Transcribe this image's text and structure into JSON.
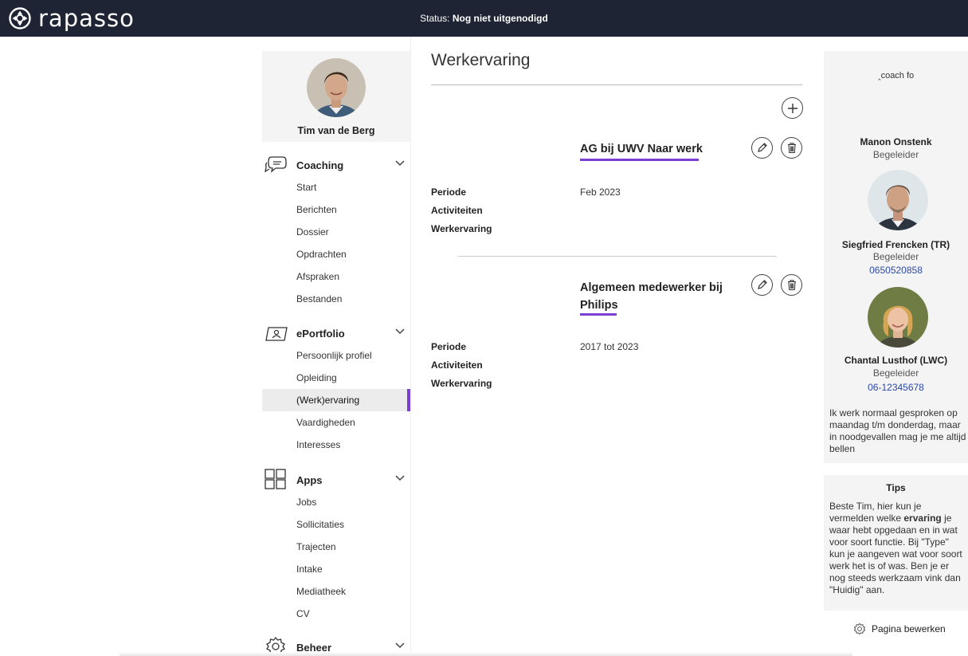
{
  "topbar": {
    "logo_text": "rapasso",
    "status_prefix": "Status:",
    "status_value": "Nog niet uitgenodigd"
  },
  "profile": {
    "name": "Tim van de Berg"
  },
  "nav": {
    "coaching": {
      "title": "Coaching",
      "items": [
        "Start",
        "Berichten",
        "Dossier",
        "Opdrachten",
        "Afspraken",
        "Bestanden"
      ]
    },
    "eportfolio": {
      "title": "ePortfolio",
      "items": [
        "Persoonlijk profiel",
        "Opleiding",
        "(Werk)ervaring",
        "Vaardigheden",
        "Interesses"
      ],
      "active_item": "(Werk)ervaring"
    },
    "apps": {
      "title": "Apps",
      "items": [
        "Jobs",
        "Sollicitaties",
        "Trajecten",
        "Intake",
        "Mediatheek",
        "CV"
      ]
    },
    "beheer": {
      "title": "Beheer"
    }
  },
  "main": {
    "title": "Werkervaring",
    "experiences": [
      {
        "title": "AG bij UWV Naar werk",
        "labels": {
          "period": "Periode",
          "activities": "Activiteiten",
          "experience": "Werkervaring"
        },
        "period": "Feb 2023"
      },
      {
        "title_line1": "Algemeen medewerker bij",
        "title_line2": "Philips",
        "labels": {
          "period": "Periode",
          "activities": "Activiteiten",
          "experience": "Werkervaring"
        },
        "period": "2017 tot 2023"
      }
    ]
  },
  "coach": {
    "caption": "‸coach fo",
    "people": [
      {
        "name": "Manon Onstenk",
        "role": "Begeleider"
      },
      {
        "name": "Siegfried Frencken (TR)",
        "role": "Begeleider",
        "phone": "0650520858"
      },
      {
        "name": "Chantal Lusthof (LWC)",
        "role": "Begeleider",
        "phone": "06-12345678"
      }
    ],
    "note": "Ik werk normaal gesproken op maandag t/m donderdag, maar in noodgevallen mag je me altijd bellen"
  },
  "tips": {
    "title": "Tips",
    "text_before": "Beste Tim, hier kun je vermelden welke ",
    "text_bold": "ervaring",
    "text_after": " je waar hebt opgedaan en in wat voor soort functie. Bij \"Type\" kun je aangeven wat voor soort werk het is of was. Ben je er nog steeds werkzaam vink dan \"Huidig\" aan."
  },
  "edit_page_label": "Pagina bewerken",
  "colors": {
    "topbar": "#1e2433",
    "accent": "#7b3fd1",
    "link": "#2a4aa8",
    "panel": "#f4f4f4"
  },
  "icons": [
    "rapasso-logo-icon",
    "speech-bubble-icon",
    "portfolio-icon",
    "apps-grid-icon",
    "gear-icon",
    "chevron-down-icon",
    "plus-icon",
    "pencil-icon",
    "trash-icon"
  ]
}
